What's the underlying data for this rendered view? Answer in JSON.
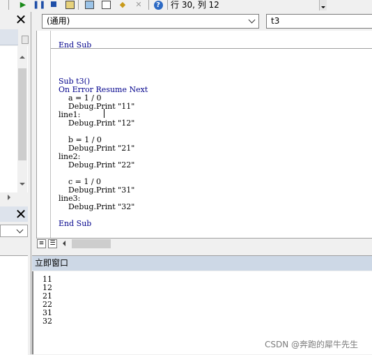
{
  "toolbar": {
    "position_text": "行 30, 列 12",
    "icons": [
      "run-icon",
      "pause-icon",
      "stop-icon",
      "design-mode-icon",
      "project-explorer-icon",
      "properties-icon",
      "object-browser-icon",
      "toolbox-icon",
      "help-icon"
    ]
  },
  "code_window": {
    "object_combo": "(通用)",
    "procedure_combo": "t3",
    "prev_proc_end": "End Sub",
    "lines": [
      {
        "kw": true,
        "text": "Sub t3()"
      },
      {
        "kw": true,
        "text": "On Error Resume Next"
      },
      {
        "kw": false,
        "text": "    a = 1 / 0"
      },
      {
        "kw": false,
        "text": "    Debug.Print \"11\""
      },
      {
        "kw": false,
        "text": "line1:"
      },
      {
        "kw": false,
        "text": "    Debug.Print \"12\""
      },
      {
        "kw": false,
        "text": ""
      },
      {
        "kw": false,
        "text": "    b = 1 / 0"
      },
      {
        "kw": false,
        "text": "    Debug.Print \"21\""
      },
      {
        "kw": false,
        "text": "line2:"
      },
      {
        "kw": false,
        "text": "    Debug.Print \"22\""
      },
      {
        "kw": false,
        "text": ""
      },
      {
        "kw": false,
        "text": "    c = 1 / 0"
      },
      {
        "kw": false,
        "text": "    Debug.Print \"31\""
      },
      {
        "kw": false,
        "text": "line3:"
      },
      {
        "kw": false,
        "text": "    Debug.Print \"32\""
      },
      {
        "kw": false,
        "text": ""
      },
      {
        "kw": true,
        "text": "End Sub"
      }
    ]
  },
  "immediate_window": {
    "title": "立即窗口",
    "output": [
      "11",
      "12",
      "21",
      "22",
      "31",
      "32"
    ]
  },
  "watermark": "CSDN @奔跑的犀牛先生",
  "colors": {
    "keyword": "#00008b",
    "immediate_title_bg": "#cdd8e6",
    "panel_bg": "#f0f0f0"
  }
}
